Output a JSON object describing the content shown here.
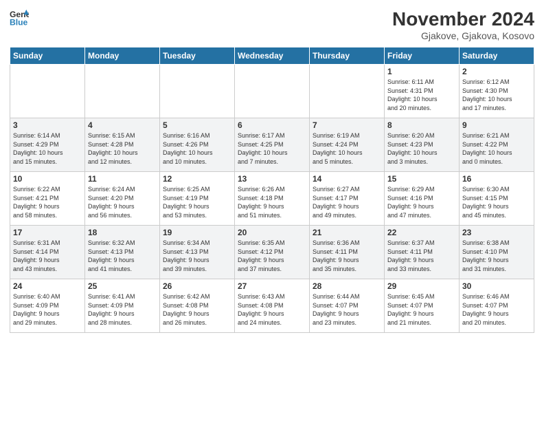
{
  "header": {
    "logo_general": "General",
    "logo_blue": "Blue",
    "month_year": "November 2024",
    "location": "Gjakove, Gjakova, Kosovo"
  },
  "days_of_week": [
    "Sunday",
    "Monday",
    "Tuesday",
    "Wednesday",
    "Thursday",
    "Friday",
    "Saturday"
  ],
  "weeks": [
    [
      {
        "day": "",
        "info": ""
      },
      {
        "day": "",
        "info": ""
      },
      {
        "day": "",
        "info": ""
      },
      {
        "day": "",
        "info": ""
      },
      {
        "day": "",
        "info": ""
      },
      {
        "day": "1",
        "info": "Sunrise: 6:11 AM\nSunset: 4:31 PM\nDaylight: 10 hours\nand 20 minutes."
      },
      {
        "day": "2",
        "info": "Sunrise: 6:12 AM\nSunset: 4:30 PM\nDaylight: 10 hours\nand 17 minutes."
      }
    ],
    [
      {
        "day": "3",
        "info": "Sunrise: 6:14 AM\nSunset: 4:29 PM\nDaylight: 10 hours\nand 15 minutes."
      },
      {
        "day": "4",
        "info": "Sunrise: 6:15 AM\nSunset: 4:28 PM\nDaylight: 10 hours\nand 12 minutes."
      },
      {
        "day": "5",
        "info": "Sunrise: 6:16 AM\nSunset: 4:26 PM\nDaylight: 10 hours\nand 10 minutes."
      },
      {
        "day": "6",
        "info": "Sunrise: 6:17 AM\nSunset: 4:25 PM\nDaylight: 10 hours\nand 7 minutes."
      },
      {
        "day": "7",
        "info": "Sunrise: 6:19 AM\nSunset: 4:24 PM\nDaylight: 10 hours\nand 5 minutes."
      },
      {
        "day": "8",
        "info": "Sunrise: 6:20 AM\nSunset: 4:23 PM\nDaylight: 10 hours\nand 3 minutes."
      },
      {
        "day": "9",
        "info": "Sunrise: 6:21 AM\nSunset: 4:22 PM\nDaylight: 10 hours\nand 0 minutes."
      }
    ],
    [
      {
        "day": "10",
        "info": "Sunrise: 6:22 AM\nSunset: 4:21 PM\nDaylight: 9 hours\nand 58 minutes."
      },
      {
        "day": "11",
        "info": "Sunrise: 6:24 AM\nSunset: 4:20 PM\nDaylight: 9 hours\nand 56 minutes."
      },
      {
        "day": "12",
        "info": "Sunrise: 6:25 AM\nSunset: 4:19 PM\nDaylight: 9 hours\nand 53 minutes."
      },
      {
        "day": "13",
        "info": "Sunrise: 6:26 AM\nSunset: 4:18 PM\nDaylight: 9 hours\nand 51 minutes."
      },
      {
        "day": "14",
        "info": "Sunrise: 6:27 AM\nSunset: 4:17 PM\nDaylight: 9 hours\nand 49 minutes."
      },
      {
        "day": "15",
        "info": "Sunrise: 6:29 AM\nSunset: 4:16 PM\nDaylight: 9 hours\nand 47 minutes."
      },
      {
        "day": "16",
        "info": "Sunrise: 6:30 AM\nSunset: 4:15 PM\nDaylight: 9 hours\nand 45 minutes."
      }
    ],
    [
      {
        "day": "17",
        "info": "Sunrise: 6:31 AM\nSunset: 4:14 PM\nDaylight: 9 hours\nand 43 minutes."
      },
      {
        "day": "18",
        "info": "Sunrise: 6:32 AM\nSunset: 4:13 PM\nDaylight: 9 hours\nand 41 minutes."
      },
      {
        "day": "19",
        "info": "Sunrise: 6:34 AM\nSunset: 4:13 PM\nDaylight: 9 hours\nand 39 minutes."
      },
      {
        "day": "20",
        "info": "Sunrise: 6:35 AM\nSunset: 4:12 PM\nDaylight: 9 hours\nand 37 minutes."
      },
      {
        "day": "21",
        "info": "Sunrise: 6:36 AM\nSunset: 4:11 PM\nDaylight: 9 hours\nand 35 minutes."
      },
      {
        "day": "22",
        "info": "Sunrise: 6:37 AM\nSunset: 4:11 PM\nDaylight: 9 hours\nand 33 minutes."
      },
      {
        "day": "23",
        "info": "Sunrise: 6:38 AM\nSunset: 4:10 PM\nDaylight: 9 hours\nand 31 minutes."
      }
    ],
    [
      {
        "day": "24",
        "info": "Sunrise: 6:40 AM\nSunset: 4:09 PM\nDaylight: 9 hours\nand 29 minutes."
      },
      {
        "day": "25",
        "info": "Sunrise: 6:41 AM\nSunset: 4:09 PM\nDaylight: 9 hours\nand 28 minutes."
      },
      {
        "day": "26",
        "info": "Sunrise: 6:42 AM\nSunset: 4:08 PM\nDaylight: 9 hours\nand 26 minutes."
      },
      {
        "day": "27",
        "info": "Sunrise: 6:43 AM\nSunset: 4:08 PM\nDaylight: 9 hours\nand 24 minutes."
      },
      {
        "day": "28",
        "info": "Sunrise: 6:44 AM\nSunset: 4:07 PM\nDaylight: 9 hours\nand 23 minutes."
      },
      {
        "day": "29",
        "info": "Sunrise: 6:45 AM\nSunset: 4:07 PM\nDaylight: 9 hours\nand 21 minutes."
      },
      {
        "day": "30",
        "info": "Sunrise: 6:46 AM\nSunset: 4:07 PM\nDaylight: 9 hours\nand 20 minutes."
      }
    ]
  ]
}
